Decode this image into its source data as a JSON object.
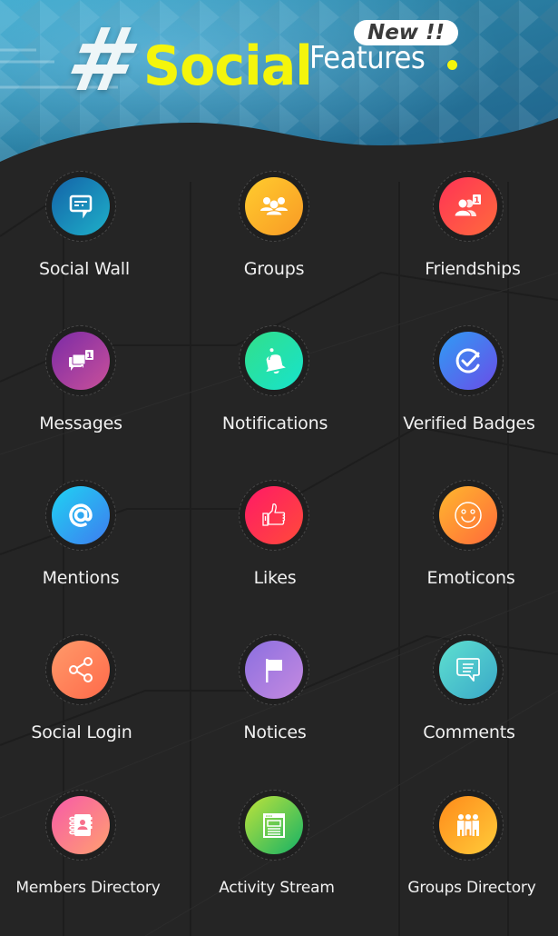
{
  "header": {
    "hash_symbol": "#",
    "title_main": "Social",
    "title_sub": "Features",
    "badge": "New !!",
    "colors": {
      "accent_yellow": "#f4f50c",
      "banner_blue": "#2a7ea2",
      "background": "#252525"
    }
  },
  "features": [
    {
      "label": "Social Wall",
      "icon": "chat-post-icon",
      "gradient": [
        "#1463a8",
        "#1eb0c9"
      ]
    },
    {
      "label": "Groups",
      "icon": "group-users-icon",
      "gradient": [
        "#ffcc2e",
        "#f99a25"
      ]
    },
    {
      "label": "Friendships",
      "icon": "friend-request-icon",
      "gradient": [
        "#ff3355",
        "#ff6a3d"
      ]
    },
    {
      "label": "Messages",
      "icon": "messages-icon",
      "gradient": [
        "#7b2ba6",
        "#c9509a"
      ]
    },
    {
      "label": "Notifications",
      "icon": "bell-icon",
      "gradient": [
        "#32e08a",
        "#17e2cc"
      ]
    },
    {
      "label": "Verified Badges",
      "icon": "verified-check-icon",
      "gradient": [
        "#2f9cf4",
        "#6a4de8"
      ]
    },
    {
      "label": "Mentions",
      "icon": "at-sign-icon",
      "gradient": [
        "#1fd3f2",
        "#3e7cf0"
      ]
    },
    {
      "label": "Likes",
      "icon": "thumbs-up-icon",
      "gradient": [
        "#ff1a66",
        "#ff4a3a"
      ]
    },
    {
      "label": "Emoticons",
      "icon": "smiley-icon",
      "gradient": [
        "#ffb72e",
        "#ff6a3a"
      ]
    },
    {
      "label": "Social Login",
      "icon": "share-icon",
      "gradient": [
        "#ff9a6a",
        "#ff6a4a"
      ]
    },
    {
      "label": "Notices",
      "icon": "flag-icon",
      "gradient": [
        "#8b6fe0",
        "#c58ae0"
      ]
    },
    {
      "label": "Comments",
      "icon": "comment-icon",
      "gradient": [
        "#5ee0d0",
        "#3aa8c8"
      ]
    },
    {
      "label": "Members Directory",
      "icon": "address-book-icon",
      "gradient": [
        "#f75aa8",
        "#ffa070"
      ]
    },
    {
      "label": "Activity Stream",
      "icon": "browser-window-icon",
      "gradient": [
        "#bfe33a",
        "#14b266"
      ]
    },
    {
      "label": "Groups Directory",
      "icon": "team-directory-icon",
      "gradient": [
        "#ff8a1a",
        "#ffcc3a"
      ]
    }
  ]
}
